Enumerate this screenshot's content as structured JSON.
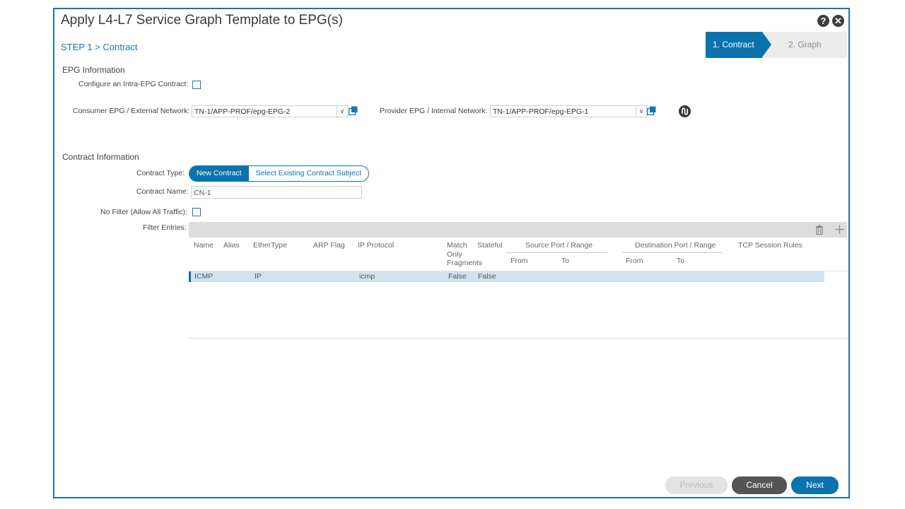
{
  "dialog": {
    "title": "Apply L4-L7 Service Graph Template to EPG(s)",
    "step": "STEP 1 > Contract",
    "help_icon": "?",
    "close_icon": "✕"
  },
  "wizard": {
    "steps": [
      {
        "label": "1. Contract",
        "active": true
      },
      {
        "label": "2. Graph",
        "active": false
      }
    ]
  },
  "epg": {
    "heading": "EPG Information",
    "intra_label": "Configure an Intra-EPG Contract:",
    "intra_checked": false,
    "consumer_label": "Consumer EPG / External Network:",
    "consumer_value": "TN-1/APP-PROF/epg-EPG-2",
    "provider_label": "Provider EPG / Internal Network:",
    "provider_value": "TN-1/APP-PROF/epg-EPG-1"
  },
  "contract": {
    "heading": "Contract Information",
    "type_label": "Contract Type:",
    "type_options": [
      "New Contract",
      "Select Existing Contract Subject"
    ],
    "type_selected": "New Contract",
    "name_label": "Contract Name:",
    "name_value": "CN-1",
    "nofilter_label": "No Filter (Allow All Traffic):",
    "nofilter_checked": false,
    "filter_label": "Filter Entries:"
  },
  "table": {
    "columns": {
      "name": "Name",
      "alias": "Alias",
      "ethertype": "EtherType",
      "arp": "ARP Flag",
      "ip_protocol": "IP Protocol",
      "match_fragments": "Match Only Fragments",
      "stateful": "Stateful",
      "source_port": "Source Port / Range",
      "dest_port": "Destination Port / Range",
      "tcp_rules": "TCP Session Rules",
      "from": "From",
      "to": "To"
    },
    "rows": [
      {
        "name": "ICMP",
        "alias": "",
        "ethertype": "IP",
        "arp": "",
        "ip_protocol": "icmp",
        "match_fragments": "False",
        "stateful": "False"
      }
    ]
  },
  "footer": {
    "previous": "Previous",
    "cancel": "Cancel",
    "next": "Next"
  },
  "colors": {
    "accent": "#0a73ad",
    "border": "#1f6fb5",
    "selected_row": "#cfe4ef"
  }
}
